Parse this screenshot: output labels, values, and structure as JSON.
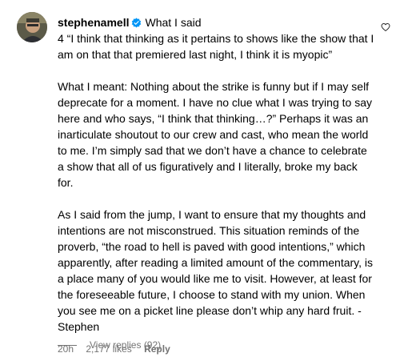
{
  "comment": {
    "username": "stephenamell",
    "verified_icon": "verified-badge-icon",
    "header_text": "What I said",
    "paragraphs": [
      "4 “I think that thinking as it pertains to shows like the show that I am on that that premiered last night, I think it is myopic”",
      "What I meant: Nothing about the strike is funny but if I may self deprecate for a moment. I have no clue what I was trying to say here and who says, “I think that thinking…?” Perhaps it was an inarticulate shoutout to our crew and cast, who mean the world to me. I’m simply sad that we don’t have a chance to celebrate a show that all of us figuratively and I literally, broke my back for.",
      "As I said from the jump, I want to ensure that my thoughts and intentions are not misconstrued. This situation reminds of the proverb, “the road to hell is paved with good intentions,” which apparently, after reading a limited amount of the commentary, is a place many of you would like me to visit. However, at least for the foreseeable future, I choose to stand with my union. When you see me on a picket line please don’t whip any hard fruit. - Stephen"
    ],
    "time": "20h",
    "likes": "2,177 likes",
    "reply_label": "Reply",
    "view_replies": "View replies (92)",
    "like_icon": "heart-icon",
    "colors": {
      "text": "#000000",
      "secondary": "#737373",
      "verified": "#0095f6"
    }
  }
}
